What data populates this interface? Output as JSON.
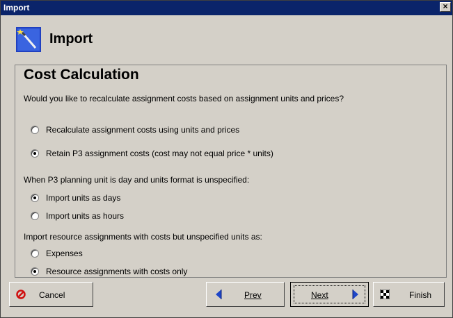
{
  "window": {
    "title": "Import",
    "close_label": "×"
  },
  "header": {
    "title": "Import",
    "icon": "wand-icon"
  },
  "section": {
    "title": "Cost Calculation",
    "question": "Would you like to recalculate assignment costs based on assignment units and prices?",
    "cost_options": [
      {
        "label": "Recalculate assignment costs using units and prices",
        "checked": false
      },
      {
        "label": "Retain P3 assignment costs (cost may not equal price * units)",
        "checked": true
      }
    ],
    "units_question": "When P3 planning unit is day and units format is unspecified:",
    "unit_options": [
      {
        "label": "Import units as days",
        "checked": true
      },
      {
        "label": "Import units as hours",
        "checked": false
      }
    ],
    "resource_question": "Import resource assignments with costs but unspecified units as:",
    "resource_options": [
      {
        "label": "Expenses",
        "checked": false
      },
      {
        "label": "Resource assignments with costs only",
        "checked": true
      }
    ]
  },
  "buttons": {
    "cancel": "Cancel",
    "prev": "Prev",
    "next": "Next",
    "finish": "Finish"
  },
  "colors": {
    "titlebar": "#0a246a",
    "face": "#d4d0c8",
    "arrow": "#1e46c8",
    "cancel_icon": "#d01010"
  }
}
